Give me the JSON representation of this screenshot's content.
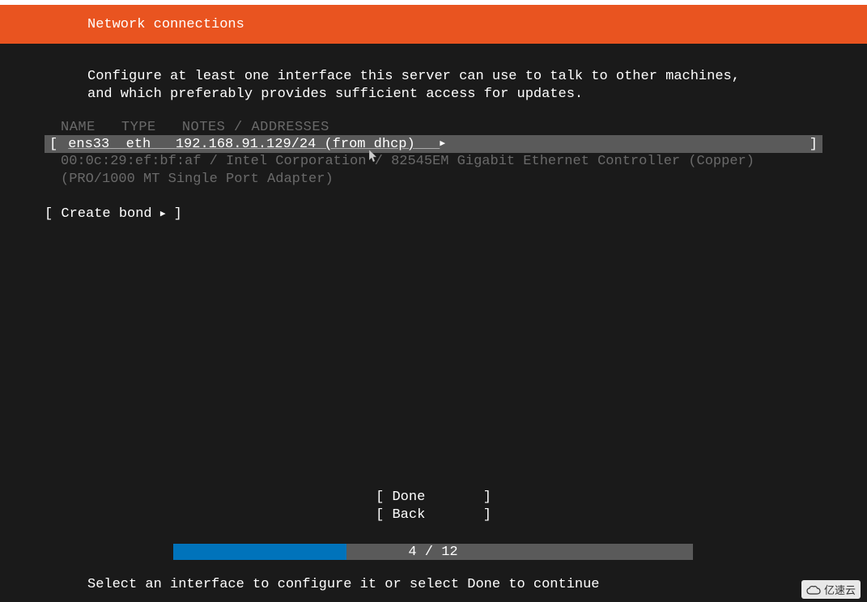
{
  "header": {
    "title": "Network connections"
  },
  "instruction": {
    "line1": "Configure at least one interface this server can use to talk to other machines,",
    "line2": "and which preferably provides sufficient access for updates."
  },
  "columns": {
    "name": "NAME",
    "type": "TYPE",
    "notes": "NOTES / ADDRESSES"
  },
  "interface": {
    "name": "ens33",
    "type": "eth",
    "address": "192.168.91.129/24 (from dhcp)",
    "detail1": "00:0c:29:ef:bf:af / Intel Corporation / 82545EM Gigabit Ethernet Controller (Copper)",
    "detail2": "(PRO/1000 MT Single Port Adapter)"
  },
  "createBond": {
    "label": "Create bond"
  },
  "buttons": {
    "done": "Done",
    "back": "Back"
  },
  "progress": {
    "current": "4",
    "total": "12",
    "text": "4 / 12"
  },
  "status": {
    "text": "Select an interface to configure it or select Done to continue"
  },
  "watermark": {
    "text": "亿速云"
  }
}
